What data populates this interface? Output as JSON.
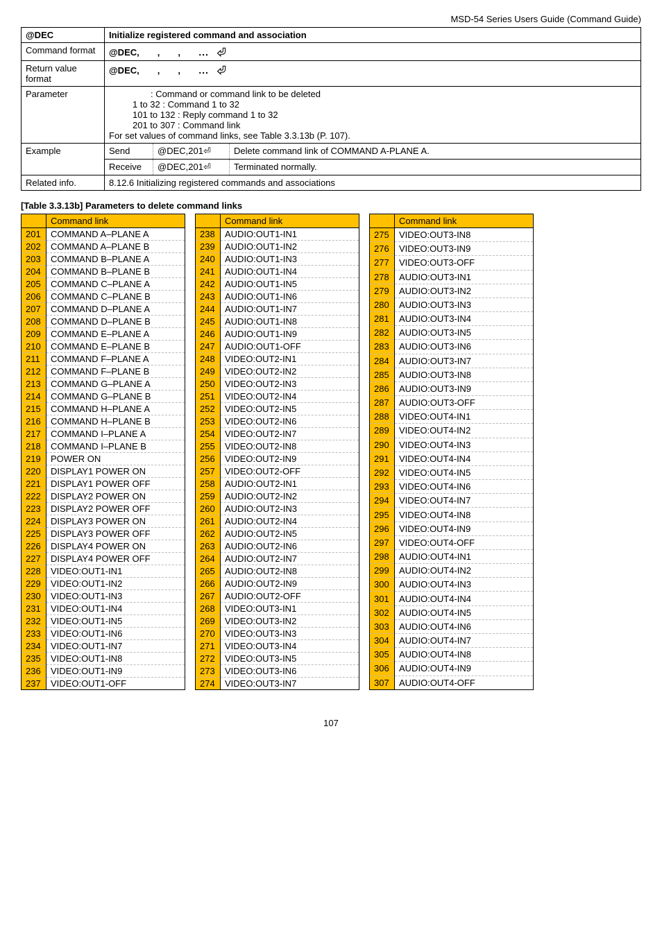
{
  "header": {
    "guide_title": "MSD-54 Series Users Guide (Command Guide)"
  },
  "cmd_table": {
    "at_dec": "@DEC",
    "init_title": "Initialize registered command and association",
    "command_label": "Command format",
    "command_val": "@DEC,　　,　　,　　⋯　⏎",
    "return_label": "Return value format",
    "return_val": "@DEC,　　,　　,　　⋯　⏎",
    "param_label": "Parameter",
    "param_l1": ": Command or command link to be deleted",
    "param_l2": "1 to   32 : Command 1 to 32",
    "param_l3": "101 to 132 : Reply command 1 to 32",
    "param_l4": "201 to 307 : Command link",
    "param_l5": "For set values of command links, see Table 3.3.13b (P. 107).",
    "example_label": "Example",
    "ex_send": "Send",
    "ex_send_cmd": "@DEC,201⏎",
    "ex_send_desc": "Delete command link of COMMAND A-PLANE A.",
    "ex_recv": "Receive",
    "ex_recv_cmd": "@DEC,201⏎",
    "ex_recv_desc": "Terminated normally.",
    "related_label": "Related info.",
    "related_val": "8.12.6 Initializing registered commands and associations"
  },
  "links_title": "[Table 3.3.13b] Parameters to delete command links",
  "col_header": "Command link",
  "col1": [
    {
      "n": "201",
      "t": "COMMAND A–PLANE A"
    },
    {
      "n": "202",
      "t": "COMMAND A–PLANE B"
    },
    {
      "n": "203",
      "t": "COMMAND B–PLANE A"
    },
    {
      "n": "204",
      "t": "COMMAND B–PLANE B"
    },
    {
      "n": "205",
      "t": "COMMAND C–PLANE A"
    },
    {
      "n": "206",
      "t": "COMMAND C–PLANE B"
    },
    {
      "n": "207",
      "t": "COMMAND D–PLANE A"
    },
    {
      "n": "208",
      "t": "COMMAND D–PLANE B"
    },
    {
      "n": "209",
      "t": "COMMAND E–PLANE A"
    },
    {
      "n": "210",
      "t": "COMMAND E–PLANE B"
    },
    {
      "n": "211",
      "t": "COMMAND F–PLANE A"
    },
    {
      "n": "212",
      "t": "COMMAND F–PLANE B"
    },
    {
      "n": "213",
      "t": "COMMAND G–PLANE A"
    },
    {
      "n": "214",
      "t": "COMMAND G–PLANE B"
    },
    {
      "n": "215",
      "t": "COMMAND H–PLANE A"
    },
    {
      "n": "216",
      "t": "COMMAND H–PLANE B"
    },
    {
      "n": "217",
      "t": "COMMAND I–PLANE A"
    },
    {
      "n": "218",
      "t": "COMMAND I–PLANE B"
    },
    {
      "n": "219",
      "t": "POWER ON"
    },
    {
      "n": "220",
      "t": "DISPLAY1 POWER ON"
    },
    {
      "n": "221",
      "t": "DISPLAY1 POWER OFF"
    },
    {
      "n": "222",
      "t": "DISPLAY2 POWER ON"
    },
    {
      "n": "223",
      "t": "DISPLAY2 POWER OFF"
    },
    {
      "n": "224",
      "t": "DISPLAY3 POWER ON"
    },
    {
      "n": "225",
      "t": "DISPLAY3 POWER OFF"
    },
    {
      "n": "226",
      "t": "DISPLAY4 POWER ON"
    },
    {
      "n": "227",
      "t": "DISPLAY4 POWER OFF"
    },
    {
      "n": "228",
      "t": "VIDEO:OUT1-IN1"
    },
    {
      "n": "229",
      "t": "VIDEO:OUT1-IN2"
    },
    {
      "n": "230",
      "t": "VIDEO:OUT1-IN3"
    },
    {
      "n": "231",
      "t": "VIDEO:OUT1-IN4"
    },
    {
      "n": "232",
      "t": "VIDEO:OUT1-IN5"
    },
    {
      "n": "233",
      "t": "VIDEO:OUT1-IN6"
    },
    {
      "n": "234",
      "t": "VIDEO:OUT1-IN7"
    },
    {
      "n": "235",
      "t": "VIDEO:OUT1-IN8"
    },
    {
      "n": "236",
      "t": "VIDEO:OUT1-IN9"
    },
    {
      "n": "237",
      "t": "VIDEO:OUT1-OFF"
    }
  ],
  "col2": [
    {
      "n": "238",
      "t": "AUDIO:OUT1-IN1"
    },
    {
      "n": "239",
      "t": "AUDIO:OUT1-IN2"
    },
    {
      "n": "240",
      "t": "AUDIO:OUT1-IN3"
    },
    {
      "n": "241",
      "t": "AUDIO:OUT1-IN4"
    },
    {
      "n": "242",
      "t": "AUDIO:OUT1-IN5"
    },
    {
      "n": "243",
      "t": "AUDIO:OUT1-IN6"
    },
    {
      "n": "244",
      "t": "AUDIO:OUT1-IN7"
    },
    {
      "n": "245",
      "t": "AUDIO:OUT1-IN8"
    },
    {
      "n": "246",
      "t": "AUDIO:OUT1-IN9"
    },
    {
      "n": "247",
      "t": "AUDIO:OUT1-OFF"
    },
    {
      "n": "248",
      "t": "VIDEO:OUT2-IN1"
    },
    {
      "n": "249",
      "t": "VIDEO:OUT2-IN2"
    },
    {
      "n": "250",
      "t": "VIDEO:OUT2-IN3"
    },
    {
      "n": "251",
      "t": "VIDEO:OUT2-IN4"
    },
    {
      "n": "252",
      "t": "VIDEO:OUT2-IN5"
    },
    {
      "n": "253",
      "t": "VIDEO:OUT2-IN6"
    },
    {
      "n": "254",
      "t": "VIDEO:OUT2-IN7"
    },
    {
      "n": "255",
      "t": "VIDEO:OUT2-IN8"
    },
    {
      "n": "256",
      "t": "VIDEO:OUT2-IN9"
    },
    {
      "n": "257",
      "t": "VIDEO:OUT2-OFF"
    },
    {
      "n": "258",
      "t": "AUDIO:OUT2-IN1"
    },
    {
      "n": "259",
      "t": "AUDIO:OUT2-IN2"
    },
    {
      "n": "260",
      "t": "AUDIO:OUT2-IN3"
    },
    {
      "n": "261",
      "t": "AUDIO:OUT2-IN4"
    },
    {
      "n": "262",
      "t": "AUDIO:OUT2-IN5"
    },
    {
      "n": "263",
      "t": "AUDIO:OUT2-IN6"
    },
    {
      "n": "264",
      "t": "AUDIO:OUT2-IN7"
    },
    {
      "n": "265",
      "t": "AUDIO:OUT2-IN8"
    },
    {
      "n": "266",
      "t": "AUDIO:OUT2-IN9"
    },
    {
      "n": "267",
      "t": "AUDIO:OUT2-OFF"
    },
    {
      "n": "268",
      "t": "VIDEO:OUT3-IN1"
    },
    {
      "n": "269",
      "t": "VIDEO:OUT3-IN2"
    },
    {
      "n": "270",
      "t": "VIDEO:OUT3-IN3"
    },
    {
      "n": "271",
      "t": "VIDEO:OUT3-IN4"
    },
    {
      "n": "272",
      "t": "VIDEO:OUT3-IN5"
    },
    {
      "n": "273",
      "t": "VIDEO:OUT3-IN6"
    },
    {
      "n": "274",
      "t": "VIDEO:OUT3-IN7"
    }
  ],
  "col3": [
    {
      "n": "275",
      "t": "VIDEO:OUT3-IN8"
    },
    {
      "n": "276",
      "t": "VIDEO:OUT3-IN9"
    },
    {
      "n": "277",
      "t": "VIDEO:OUT3-OFF"
    },
    {
      "n": "278",
      "t": "AUDIO:OUT3-IN1"
    },
    {
      "n": "279",
      "t": "AUDIO:OUT3-IN2"
    },
    {
      "n": "280",
      "t": "AUDIO:OUT3-IN3"
    },
    {
      "n": "281",
      "t": "AUDIO:OUT3-IN4"
    },
    {
      "n": "282",
      "t": "AUDIO:OUT3-IN5"
    },
    {
      "n": "283",
      "t": "AUDIO:OUT3-IN6"
    },
    {
      "n": "284",
      "t": "AUDIO:OUT3-IN7"
    },
    {
      "n": "285",
      "t": "AUDIO:OUT3-IN8"
    },
    {
      "n": "286",
      "t": "AUDIO:OUT3-IN9"
    },
    {
      "n": "287",
      "t": "AUDIO:OUT3-OFF"
    },
    {
      "n": "288",
      "t": "VIDEO:OUT4-IN1"
    },
    {
      "n": "289",
      "t": "VIDEO:OUT4-IN2"
    },
    {
      "n": "290",
      "t": "VIDEO:OUT4-IN3"
    },
    {
      "n": "291",
      "t": "VIDEO:OUT4-IN4"
    },
    {
      "n": "292",
      "t": "VIDEO:OUT4-IN5"
    },
    {
      "n": "293",
      "t": "VIDEO:OUT4-IN6"
    },
    {
      "n": "294",
      "t": "VIDEO:OUT4-IN7"
    },
    {
      "n": "295",
      "t": "VIDEO:OUT4-IN8"
    },
    {
      "n": "296",
      "t": "VIDEO:OUT4-IN9"
    },
    {
      "n": "297",
      "t": "VIDEO:OUT4-OFF"
    },
    {
      "n": "298",
      "t": "AUDIO:OUT4-IN1"
    },
    {
      "n": "299",
      "t": "AUDIO:OUT4-IN2"
    },
    {
      "n": "300",
      "t": "AUDIO:OUT4-IN3"
    },
    {
      "n": "301",
      "t": "AUDIO:OUT4-IN4"
    },
    {
      "n": "302",
      "t": "AUDIO:OUT4-IN5"
    },
    {
      "n": "303",
      "t": "AUDIO:OUT4-IN6"
    },
    {
      "n": "304",
      "t": "AUDIO:OUT4-IN7"
    },
    {
      "n": "305",
      "t": "AUDIO:OUT4-IN8"
    },
    {
      "n": "306",
      "t": "AUDIO:OUT4-IN9"
    },
    {
      "n": "307",
      "t": "AUDIO:OUT4-OFF"
    }
  ],
  "page_number": "107"
}
